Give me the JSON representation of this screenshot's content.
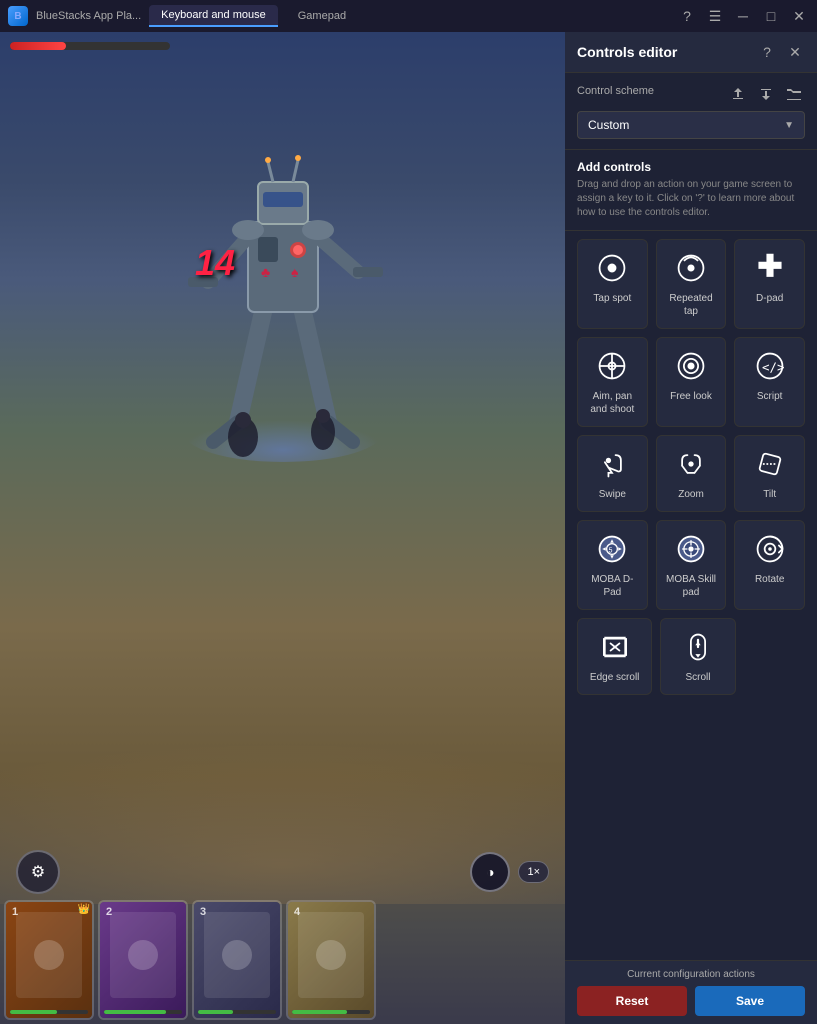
{
  "titlebar": {
    "app_name": "BlueStacks App Pla...",
    "tab_keyboard": "Keyboard and mouse",
    "tab_gamepad": "Gamepad"
  },
  "panel": {
    "title": "Controls editor",
    "scheme_label": "Control scheme",
    "scheme_value": "Custom",
    "add_controls_title": "Add controls",
    "add_controls_desc": "Drag and drop an action on your game screen to assign a key to it. Click on '?' to learn more about how to use the controls editor.",
    "bottom_label": "Current configuration actions",
    "btn_reset": "Reset",
    "btn_save": "Save"
  },
  "controls": [
    {
      "id": "tap-spot",
      "label": "Tap spot",
      "icon": "tap"
    },
    {
      "id": "repeated-tap",
      "label": "Repeated tap",
      "icon": "repeated-tap"
    },
    {
      "id": "d-pad",
      "label": "D-pad",
      "icon": "dpad"
    },
    {
      "id": "aim-pan-shoot",
      "label": "Aim, pan and shoot",
      "icon": "aim"
    },
    {
      "id": "free-look",
      "label": "Free look",
      "icon": "free-look"
    },
    {
      "id": "script",
      "label": "Script",
      "icon": "script"
    },
    {
      "id": "swipe",
      "label": "Swipe",
      "icon": "swipe"
    },
    {
      "id": "zoom",
      "label": "Zoom",
      "icon": "zoom"
    },
    {
      "id": "tilt",
      "label": "Tilt",
      "icon": "tilt"
    },
    {
      "id": "moba-dpad",
      "label": "MOBA D-Pad",
      "icon": "moba-dpad"
    },
    {
      "id": "moba-skill",
      "label": "MOBA Skill pad",
      "icon": "moba-skill"
    },
    {
      "id": "rotate",
      "label": "Rotate",
      "icon": "rotate"
    },
    {
      "id": "edge-scroll",
      "label": "Edge scroll",
      "icon": "edge-scroll"
    },
    {
      "id": "scroll",
      "label": "Scroll",
      "icon": "scroll"
    }
  ],
  "game": {
    "damage_number": "14",
    "char_cards": [
      {
        "num": "1",
        "hp_pct": 60
      },
      {
        "num": "2",
        "hp_pct": 80
      },
      {
        "num": "3",
        "hp_pct": 45
      },
      {
        "num": "4",
        "hp_pct": 70
      }
    ]
  }
}
